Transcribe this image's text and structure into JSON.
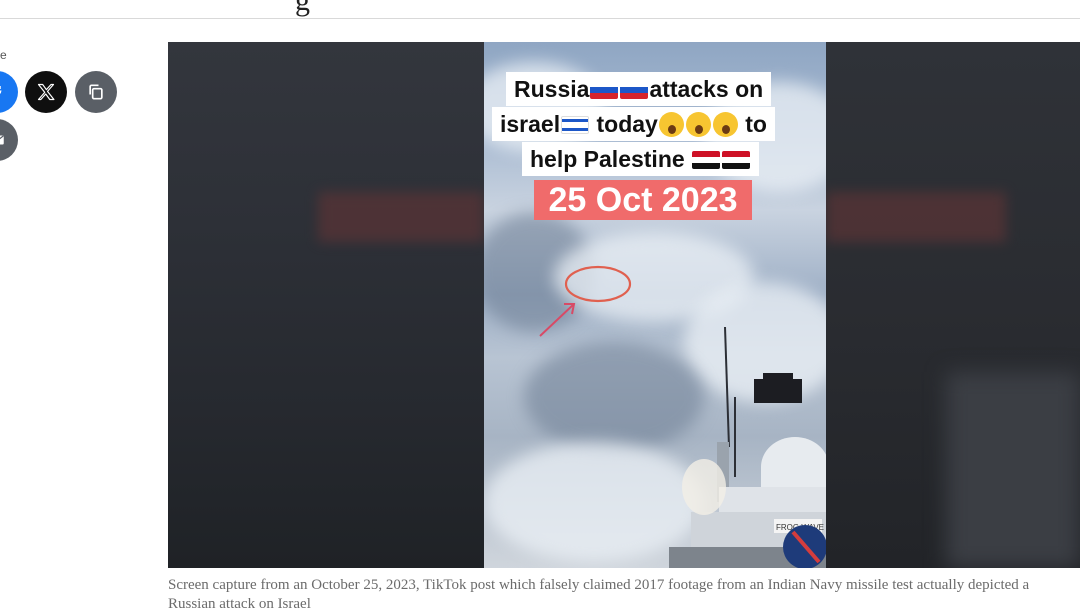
{
  "header": {
    "title_fragment": "g"
  },
  "share": {
    "label": "re",
    "buttons": [
      {
        "name": "facebook",
        "icon": "facebook-icon"
      },
      {
        "name": "x",
        "icon": "x-icon"
      },
      {
        "name": "copy-link",
        "icon": "copy-icon"
      },
      {
        "name": "email",
        "icon": "mail-icon"
      }
    ]
  },
  "video": {
    "overlay_line1": "Russia",
    "overlay_line1b": "attacks on",
    "overlay_line2a": "israel",
    "overlay_line2b": "today",
    "overlay_line2c": "to",
    "overlay_line3": "help Palestine",
    "date": "25 Oct 2023",
    "ship_label": "FROG WAVE"
  },
  "caption": "Screen capture from an October 25, 2023, TikTok post which falsely claimed 2017 footage from an Indian Navy missile test actually depicted a Russian attack on Israel",
  "colors": {
    "accent_red": "#f06b6b",
    "facebook": "#1877f2",
    "x": "#0f0f0f",
    "gray_button": "#5a5f66"
  }
}
